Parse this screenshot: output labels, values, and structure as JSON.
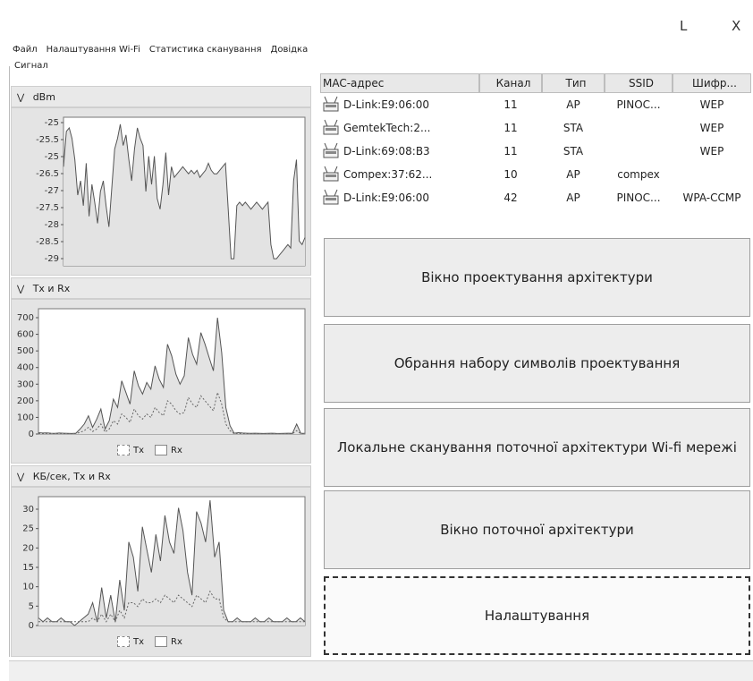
{
  "window": {
    "minimize_glyph": "L",
    "close_glyph": "X"
  },
  "menu": {
    "items": [
      "Файл",
      "Налаштування Wi-Fi",
      "Статистика сканування",
      "Довідка"
    ]
  },
  "left_panel": {
    "group_title": "Сигнал",
    "sections": [
      {
        "title": "dBm",
        "chevron": "⇲"
      },
      {
        "title": "Tx и Rx",
        "chevron": "⇲"
      },
      {
        "title": "КБ/сек, Tx и Rx",
        "chevron": "⇲"
      }
    ],
    "legend": {
      "tx": "Tx",
      "rx": "Rx"
    }
  },
  "chart_data": [
    {
      "type": "area",
      "ylabel": "dBm",
      "yticks": [
        "-25",
        "-25.5",
        "-25",
        "-26.5",
        "-27",
        "-27.5",
        "-28",
        "-28.5",
        "-29"
      ],
      "series": [
        {
          "values": [
            -26.4,
            -25.4,
            -25.3,
            -25.6,
            -26.2,
            -27.2,
            -26.8,
            -27.5,
            -26.3,
            -27.8,
            -26.9,
            -27.4,
            -28.0,
            -27.1,
            -26.8,
            -27.5,
            -28.1,
            -27.0,
            -25.9,
            -25.6,
            -25.2,
            -25.8,
            -25.5,
            -26.2,
            -26.8,
            -25.9,
            -25.3,
            -25.6,
            -25.8,
            -27.1,
            -26.1,
            -26.9,
            -26.1,
            -27.3,
            -27.6,
            -26.9,
            -26.0,
            -27.2,
            -26.4,
            -26.7,
            -26.6,
            -26.5,
            -26.4,
            -26.5,
            -26.6,
            -26.5,
            -26.6,
            -26.5,
            -26.7,
            -26.6,
            -26.5,
            -26.3,
            -26.5,
            -26.6,
            -26.6,
            -26.5,
            -26.4,
            -26.3,
            -27.6,
            -29.0,
            -29.0,
            -27.5,
            -27.4,
            -27.5,
            -27.4,
            -27.5,
            -27.6,
            -27.5,
            -27.4,
            -27.5,
            -27.6,
            -27.5,
            -27.4,
            -28.6,
            -29.0,
            -29.0,
            -28.9,
            -28.8,
            -28.7,
            -28.6,
            -28.7,
            -26.8,
            -26.2,
            -28.5,
            -28.6,
            -28.4
          ]
        }
      ]
    },
    {
      "type": "area",
      "yticks": [
        "700",
        "600",
        "500",
        "400",
        "300",
        "200",
        "100",
        "0"
      ],
      "ylim": [
        0,
        700
      ],
      "series": [
        {
          "name": "Tx",
          "values": [
            8,
            6,
            7,
            5,
            4,
            6,
            5,
            4,
            3,
            5,
            30,
            60,
            110,
            40,
            90,
            150,
            30,
            80,
            210,
            160,
            320,
            250,
            180,
            380,
            290,
            240,
            310,
            270,
            410,
            330,
            280,
            540,
            470,
            360,
            300,
            350,
            580,
            480,
            420,
            610,
            540,
            460,
            380,
            700,
            490,
            160,
            50,
            5,
            8,
            6,
            5,
            4,
            5,
            4,
            3,
            4,
            5,
            4,
            3,
            4,
            5,
            4,
            60,
            5,
            4
          ]
        },
        {
          "name": "Rx",
          "values": [
            3,
            2,
            3,
            2,
            2,
            3,
            2,
            2,
            2,
            3,
            10,
            20,
            40,
            15,
            30,
            60,
            12,
            30,
            80,
            60,
            120,
            100,
            70,
            150,
            110,
            90,
            120,
            100,
            160,
            130,
            110,
            200,
            180,
            140,
            120,
            130,
            220,
            180,
            160,
            230,
            200,
            170,
            140,
            250,
            180,
            60,
            20,
            2,
            3,
            2,
            2,
            2,
            2,
            2,
            2,
            2,
            2,
            2,
            2,
            2,
            2,
            2,
            20,
            2,
            2
          ]
        }
      ],
      "legend": "bottom-center"
    },
    {
      "type": "area",
      "yticks": [
        "30",
        "25",
        "20",
        "15",
        "10",
        "5",
        "0"
      ],
      "ylim": [
        0,
        33
      ],
      "series": [
        {
          "name": "Tx",
          "values": [
            2,
            1,
            2,
            1,
            1,
            2,
            1,
            1,
            0,
            1,
            2,
            3,
            6,
            1,
            10,
            2,
            8,
            1,
            12,
            4,
            22,
            18,
            9,
            26,
            20,
            14,
            24,
            17,
            29,
            22,
            19,
            31,
            25,
            14,
            8,
            30,
            27,
            22,
            33,
            18,
            22,
            4,
            1,
            1,
            2,
            1,
            1,
            1,
            2,
            1,
            1,
            2,
            1,
            1,
            1,
            2,
            1,
            1,
            2,
            1
          ]
        },
        {
          "name": "Rx",
          "values": [
            1,
            1,
            1,
            1,
            1,
            1,
            1,
            1,
            1,
            1,
            1,
            1,
            2,
            1,
            3,
            1,
            3,
            1,
            4,
            2,
            6,
            6,
            5,
            7,
            6,
            6,
            7,
            6,
            8,
            7,
            6,
            8,
            7,
            6,
            5,
            8,
            7,
            6,
            9,
            7,
            7,
            2,
            1,
            1,
            1,
            1,
            1,
            1,
            1,
            1,
            1,
            1,
            1,
            1,
            1,
            1,
            1,
            1,
            1,
            1
          ]
        }
      ],
      "legend": "bottom-center"
    }
  ],
  "table": {
    "headers": [
      "MAC-адрес",
      "Канал",
      "Тип",
      "SSID",
      "Шифр..."
    ],
    "rows": [
      {
        "mac": "D-Link:E9:06:00",
        "channel": "11",
        "type": "AP",
        "ssid": "PINOC...",
        "enc": "WEP"
      },
      {
        "mac": "GemtekTech:2...",
        "channel": "11",
        "type": "STA",
        "ssid": "",
        "enc": "WEP"
      },
      {
        "mac": "D-Link:69:08:B3",
        "channel": "11",
        "type": "STA",
        "ssid": "",
        "enc": "WEP"
      },
      {
        "mac": "Compex:37:62...",
        "channel": "10",
        "type": "AP",
        "ssid": "compex",
        "enc": ""
      },
      {
        "mac": "D-Link:E9:06:00",
        "channel": "42",
        "type": "AP",
        "ssid": "PINOC...",
        "enc": "WPA-CCMP"
      }
    ]
  },
  "buttons": {
    "architecture_design": "Вікно проектування архітектури",
    "symbol_set": "Обрання набору символів проектування",
    "local_scan": "Локальне сканування поточної архітектури Wi-fi мережі",
    "current_architecture": "Вікно поточної архітектури",
    "settings": "Налаштування"
  },
  "colors": {
    "plot_fill": "#e3e3e3",
    "plot_line": "#555555",
    "panel_bg": "#e4e4e4"
  }
}
